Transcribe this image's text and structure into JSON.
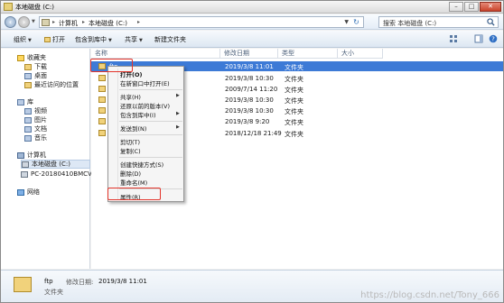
{
  "window": {
    "title": "本地磁盘 (C:)",
    "controls": {
      "minimize": "–",
      "maximize": "□",
      "close": "✕"
    }
  },
  "address": {
    "crumbs": [
      "计算机",
      "本地磁盘 (C:)"
    ],
    "search_placeholder": "搜索 本地磁盘 (C:)"
  },
  "toolbar": {
    "organize": "组织",
    "open": "打开",
    "include_in_library": "包含到库中",
    "share": "共享",
    "new_folder": "新建文件夹"
  },
  "nav": {
    "favorites": "收藏夹",
    "downloads": "下载",
    "desktop": "桌面",
    "recent": "最近访问的位置",
    "libraries": "库",
    "videos": "视频",
    "pictures": "图片",
    "documents": "文档",
    "music": "音乐",
    "computer": "计算机",
    "local_disk": "本地磁盘 (C:)",
    "network_pc": "PC-20180410BMCV 上",
    "network": "网络"
  },
  "columns": {
    "name": "名称",
    "modified": "修改日期",
    "type": "类型",
    "size": "大小"
  },
  "files": [
    {
      "name": "ftp",
      "modified": "2019/3/8 11:01",
      "type": "文件夹"
    },
    {
      "name": "",
      "modified": "2019/3/8 10:30",
      "type": "文件夹"
    },
    {
      "name": "",
      "modified": "2009/7/14 11:20",
      "type": "文件夹"
    },
    {
      "name": "",
      "modified": "2019/3/8 10:30",
      "type": "文件夹"
    },
    {
      "name": "",
      "modified": "2019/3/8 10:30",
      "type": "文件夹"
    },
    {
      "name": "",
      "modified": "2019/3/8 9:20",
      "type": "文件夹"
    },
    {
      "name": "",
      "modified": "2018/12/18 21:49",
      "type": "文件夹"
    }
  ],
  "context_menu": {
    "open": "打开(O)",
    "open_new_window": "在新窗口中打开(E)",
    "share": "共享(H)",
    "restore_previous": "还原以前的版本(V)",
    "include_in_library": "包含到库中(I)",
    "send_to": "发送到(N)",
    "cut": "剪切(T)",
    "copy": "复制(C)",
    "create_shortcut": "创建快捷方式(S)",
    "delete": "删除(D)",
    "rename": "重命名(M)",
    "properties": "属性(R)"
  },
  "details": {
    "name": "ftp",
    "modified_label": "修改日期:",
    "modified": "2019/3/8 11:01",
    "type": "文件夹"
  },
  "watermark": "https://blog.csdn.net/Tony_666",
  "colors": {
    "selection": "#3d7ad6",
    "annotation": "#e3342a"
  }
}
